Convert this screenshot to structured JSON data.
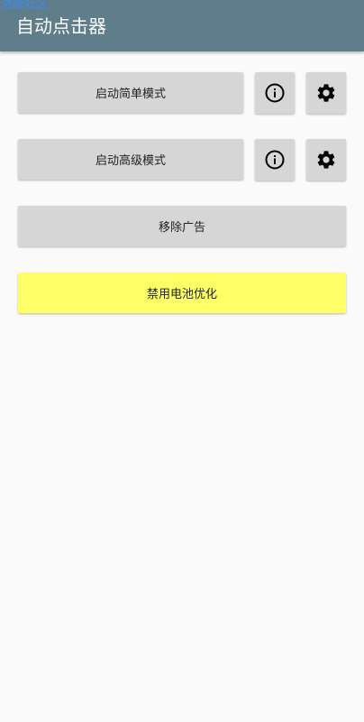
{
  "watermark": "浓腮社区",
  "app_title": "自动点击器",
  "buttons": {
    "simple_mode": "启动简单模式",
    "advanced_mode": "启动高级模式",
    "remove_ads": "移除广告",
    "disable_battery_opt": "禁用电池优化"
  },
  "icons": {
    "info": "info-icon",
    "settings": "gear-icon"
  },
  "colors": {
    "appbar": "#607d8b",
    "button": "#d6d6d6",
    "battery_button": "#ffff66",
    "background": "#fafafa"
  }
}
